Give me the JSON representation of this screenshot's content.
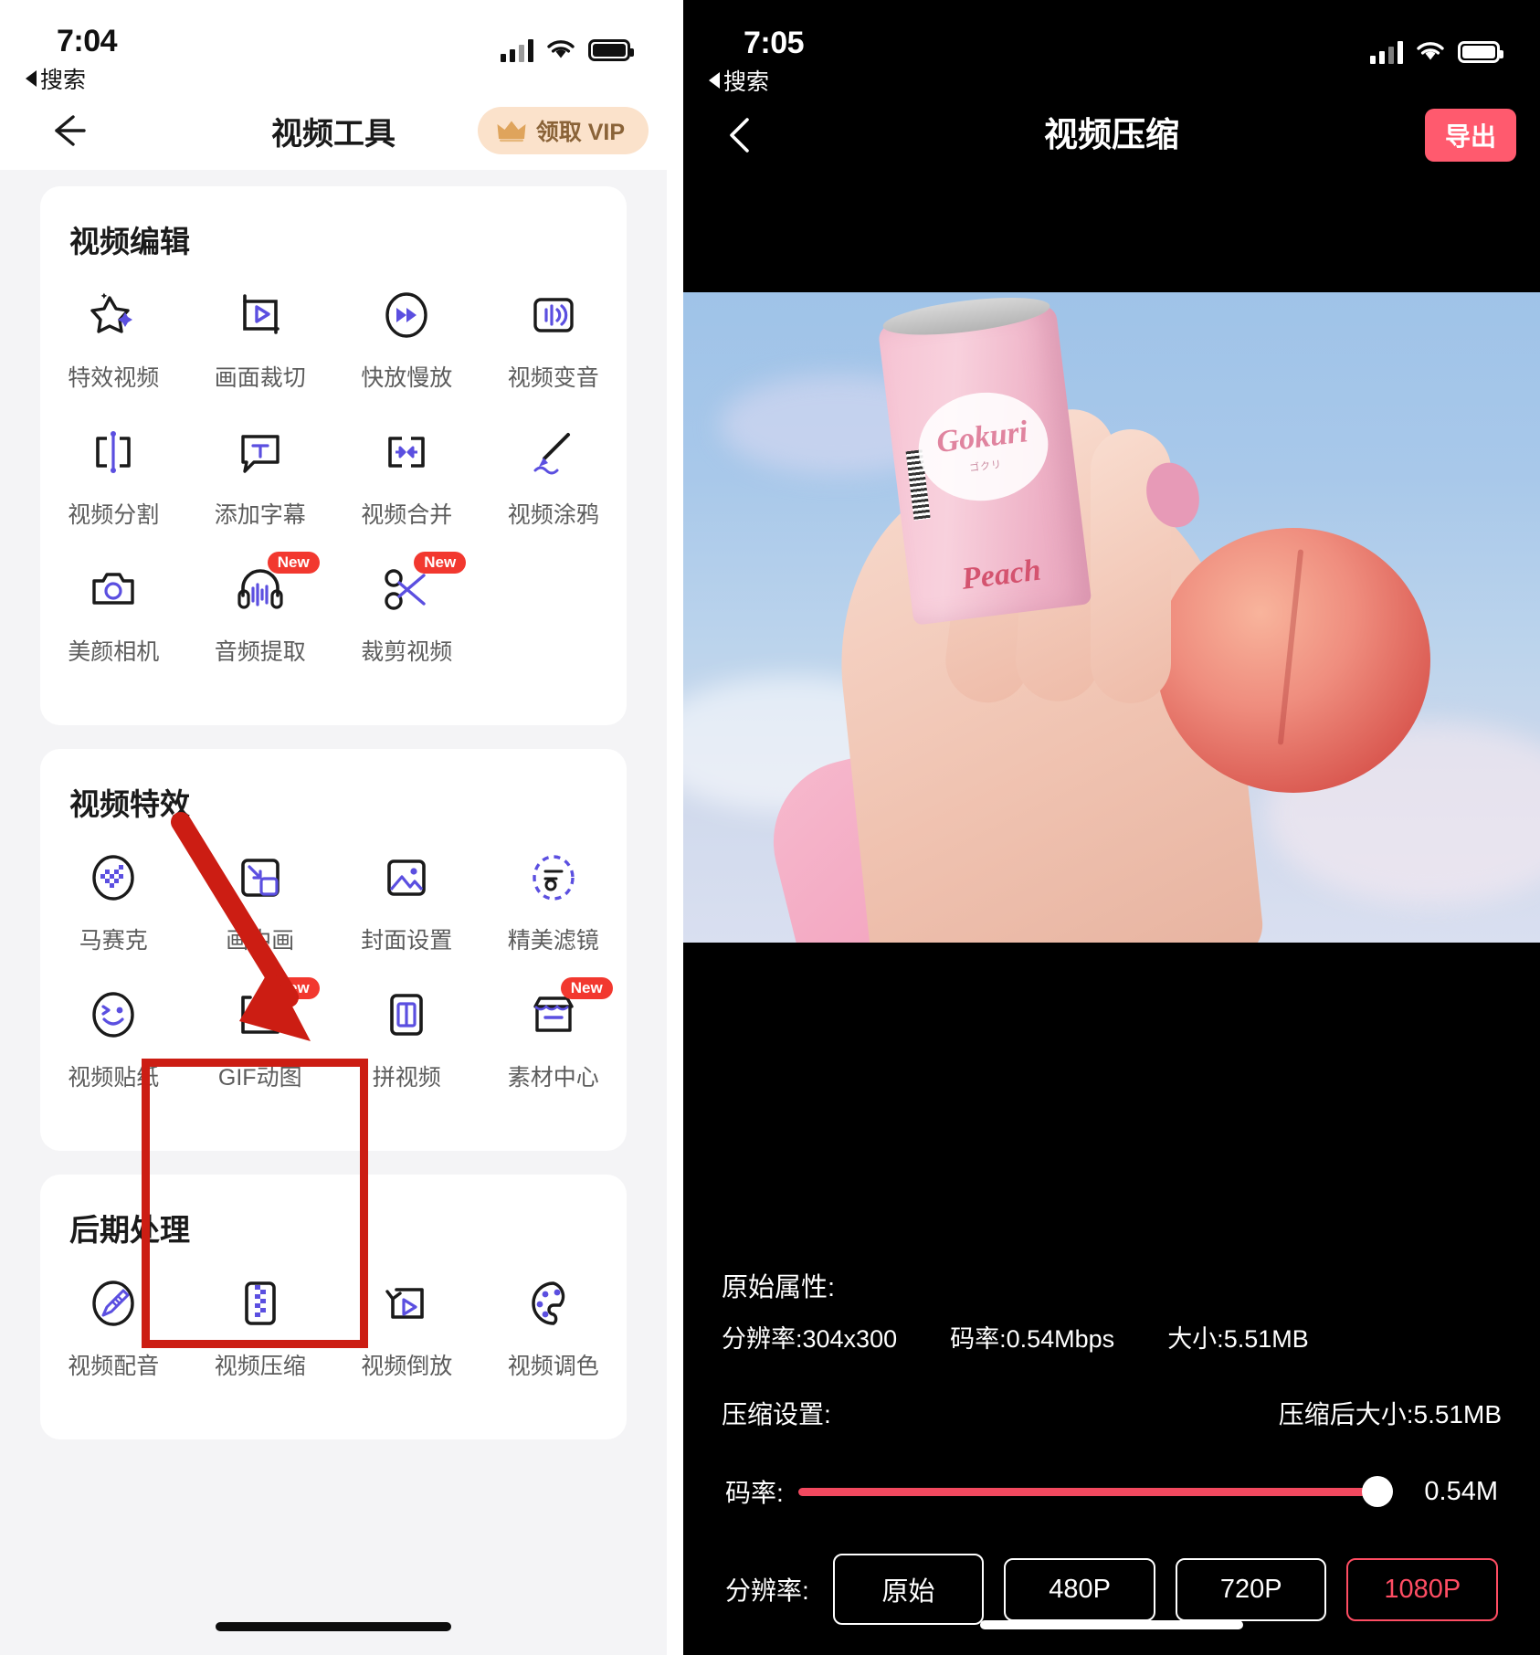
{
  "left_phone": {
    "status_bar": {
      "time": "7:04",
      "back_label": "搜索"
    },
    "nav": {
      "title": "视频工具",
      "vip_label": "领取 VIP",
      "back_icon": "arrow-left-icon",
      "crown_icon": "crown-icon"
    },
    "sections": [
      {
        "title": "视频编辑",
        "tools": [
          {
            "label": "特效视频",
            "icon": "sparkle-star-icon",
            "badge": ""
          },
          {
            "label": "画面裁切",
            "icon": "crop-play-icon",
            "badge": ""
          },
          {
            "label": "快放慢放",
            "icon": "fast-forward-icon",
            "badge": ""
          },
          {
            "label": "视频变音",
            "icon": "voice-change-icon",
            "badge": ""
          },
          {
            "label": "视频分割",
            "icon": "split-icon",
            "badge": ""
          },
          {
            "label": "添加字幕",
            "icon": "subtitle-text-icon",
            "badge": ""
          },
          {
            "label": "视频合并",
            "icon": "merge-arrows-icon",
            "badge": ""
          },
          {
            "label": "视频涂鸦",
            "icon": "brush-doodle-icon",
            "badge": ""
          },
          {
            "label": "美颜相机",
            "icon": "camera-beauty-icon",
            "badge": ""
          },
          {
            "label": "音频提取",
            "icon": "headphone-wave-icon",
            "badge": "New"
          },
          {
            "label": "裁剪视频",
            "icon": "scissors-cut-icon",
            "badge": "New"
          }
        ]
      },
      {
        "title": "视频特效",
        "tools": [
          {
            "label": "马赛克",
            "icon": "mosaic-icon",
            "badge": ""
          },
          {
            "label": "画中画",
            "icon": "picture-in-picture-icon",
            "badge": ""
          },
          {
            "label": "封面设置",
            "icon": "cover-image-icon",
            "badge": ""
          },
          {
            "label": "精美滤镜",
            "icon": "filter-dashed-icon",
            "badge": ""
          },
          {
            "label": "视频贴纸",
            "icon": "sticker-smiley-icon",
            "badge": ""
          },
          {
            "label": "GIF动图",
            "icon": "gif-icon",
            "badge": "New"
          },
          {
            "label": "拼视频",
            "icon": "split-screen-icon",
            "badge": ""
          },
          {
            "label": "素材中心",
            "icon": "material-store-icon",
            "badge": "New"
          }
        ]
      },
      {
        "title": "后期处理",
        "tools": [
          {
            "label": "视频配音",
            "icon": "dubbing-mic-icon",
            "badge": ""
          },
          {
            "label": "视频压缩",
            "icon": "compress-zip-icon",
            "badge": ""
          },
          {
            "label": "视频倒放",
            "icon": "reverse-play-icon",
            "badge": ""
          },
          {
            "label": "视频调色",
            "icon": "color-palette-icon",
            "badge": ""
          }
        ]
      }
    ]
  },
  "right_phone": {
    "status_bar": {
      "time": "7:05",
      "back_label": "搜索"
    },
    "nav": {
      "title": "视频压缩",
      "export_label": "导出",
      "back_icon": "chevron-left-icon"
    },
    "info": {
      "original_heading": "原始属性:",
      "resolution": "分辨率:304x300",
      "bitrate": "码率:0.54Mbps",
      "size": "大小:5.51MB",
      "settings_heading": "压缩设置:",
      "compressed_size": "压缩后大小:5.51MB"
    },
    "bitrate_slider": {
      "label": "码率:",
      "value": "0.54M",
      "percent": 100
    },
    "resolution_picker": {
      "label": "分辨率:",
      "options": [
        {
          "label": "原始",
          "active": false
        },
        {
          "label": "480P",
          "active": false
        },
        {
          "label": "720P",
          "active": false
        },
        {
          "label": "1080P",
          "active": true
        }
      ]
    }
  },
  "annotations": {
    "arrow_color": "#cc1d13",
    "box_color": "#cc1d13",
    "arrow_points_to": "视频压缩",
    "box_highlights": "视频压缩"
  },
  "colors": {
    "accent_purple": "#5b4fe0",
    "badge_red": "#f2382f",
    "vip_bg": "#fbe2cb",
    "vip_text": "#8a6338",
    "export_pink": "#ff5a6e",
    "slider_red": "#f2495f",
    "active_res": "#ff4d63",
    "page_bg": "#f4f4f6"
  }
}
